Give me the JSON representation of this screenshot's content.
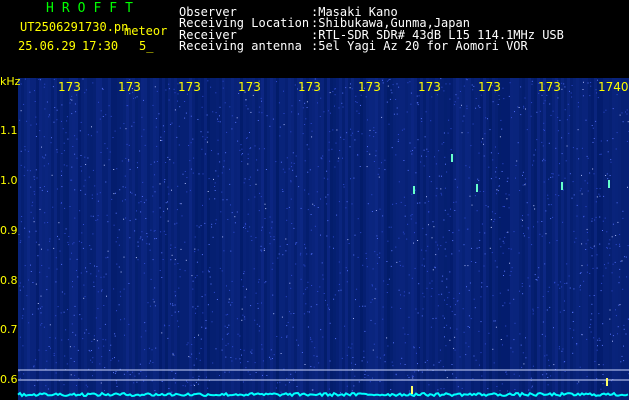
{
  "header": {
    "logo": "HROFFT",
    "filename": "UT2506291730.pn",
    "suffix": "meteor",
    "date": "25.06.29",
    "time": "17:30",
    "interval": "5_",
    "fields": [
      {
        "label": "Observer",
        "value": ":Masaki Kano"
      },
      {
        "label": "Receiving Location",
        "value": ":Shibukawa,Gunma,Japan"
      },
      {
        "label": "Receiver",
        "value": ":RTL-SDR SDR# 43dB L15 114.1MHz USB"
      },
      {
        "label": "Receiving antenna",
        "value": ":5el Yagi Az 20 for Aomori VOR"
      }
    ]
  },
  "axis": {
    "unit": "kHz",
    "y_ticks": [
      "1.1",
      "1.0",
      "0.9",
      "0.8",
      "0.7",
      "0.6"
    ],
    "x_ticks": [
      "173",
      "173",
      "173",
      "173",
      "173",
      "173",
      "173",
      "173",
      "173",
      "1740"
    ]
  },
  "colors": {
    "background": "#000000",
    "spectrogram_base": "#001a66",
    "noise": "#3a5cff",
    "trace": "#00ffff",
    "axis_text": "#ffff00",
    "logo": "#00ff00"
  }
}
